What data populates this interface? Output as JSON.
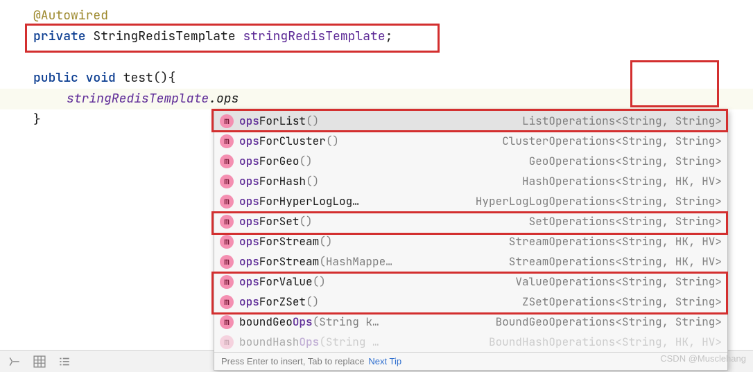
{
  "code": {
    "annotation": "@Autowired",
    "decl_private": "private",
    "decl_type": "StringRedisTemplate",
    "decl_field": "stringRedisTemplate",
    "decl_semi": ";",
    "sig_public": "public",
    "sig_void": "void",
    "sig_name": "test",
    "sig_parens": "(){",
    "call_receiver": "stringRedisTemplate",
    "call_dot": ".",
    "call_typed": "ops",
    "close_brace": "}"
  },
  "popup": {
    "rows": [
      {
        "match": "ops",
        "rest": "ForList",
        "params": "()",
        "ret": "ListOperations<String, String>",
        "selected": true
      },
      {
        "match": "ops",
        "rest": "ForCluster",
        "params": "()",
        "ret": "ClusterOperations<String, String>",
        "selected": false
      },
      {
        "match": "ops",
        "rest": "ForGeo",
        "params": "()",
        "ret": "GeoOperations<String, String>",
        "selected": false
      },
      {
        "match": "ops",
        "rest": "ForHash",
        "params": "()",
        "ret": "HashOperations<String, HK, HV>",
        "selected": false
      },
      {
        "match": "ops",
        "rest": "ForHyperLogLog…",
        "params": "",
        "ret": "HyperLogLogOperations<String, String>",
        "selected": false
      },
      {
        "match": "ops",
        "rest": "ForSet",
        "params": "()",
        "ret": "SetOperations<String, String>",
        "selected": false
      },
      {
        "match": "ops",
        "rest": "ForStream",
        "params": "()",
        "ret": "StreamOperations<String, HK, HV>",
        "selected": false
      },
      {
        "match": "ops",
        "rest": "ForStream",
        "params": "(HashMappe…",
        "ret": "StreamOperations<String, HK, HV>",
        "selected": false
      },
      {
        "match": "ops",
        "rest": "ForValue",
        "params": "()",
        "ret": "ValueOperations<String, String>",
        "selected": false
      },
      {
        "match": "ops",
        "rest": "ForZSet",
        "params": "()",
        "ret": "ZSetOperations<String, String>",
        "selected": false
      },
      {
        "match": "",
        "rest": "boundGeo",
        "match2": "Ops",
        "params": "(String k…",
        "ret": "BoundGeoOperations<String, String>",
        "selected": false
      },
      {
        "match": "",
        "rest": "boundHash",
        "match2": "Ops",
        "params": "(String …",
        "ret": "BoundHashOperations<String, HK, HV>",
        "selected": false,
        "clipped": true
      }
    ],
    "footer_hint": "Press Enter to insert, Tab to replace",
    "footer_link": "Next Tip"
  },
  "watermark": "CSDN @Musclehang"
}
